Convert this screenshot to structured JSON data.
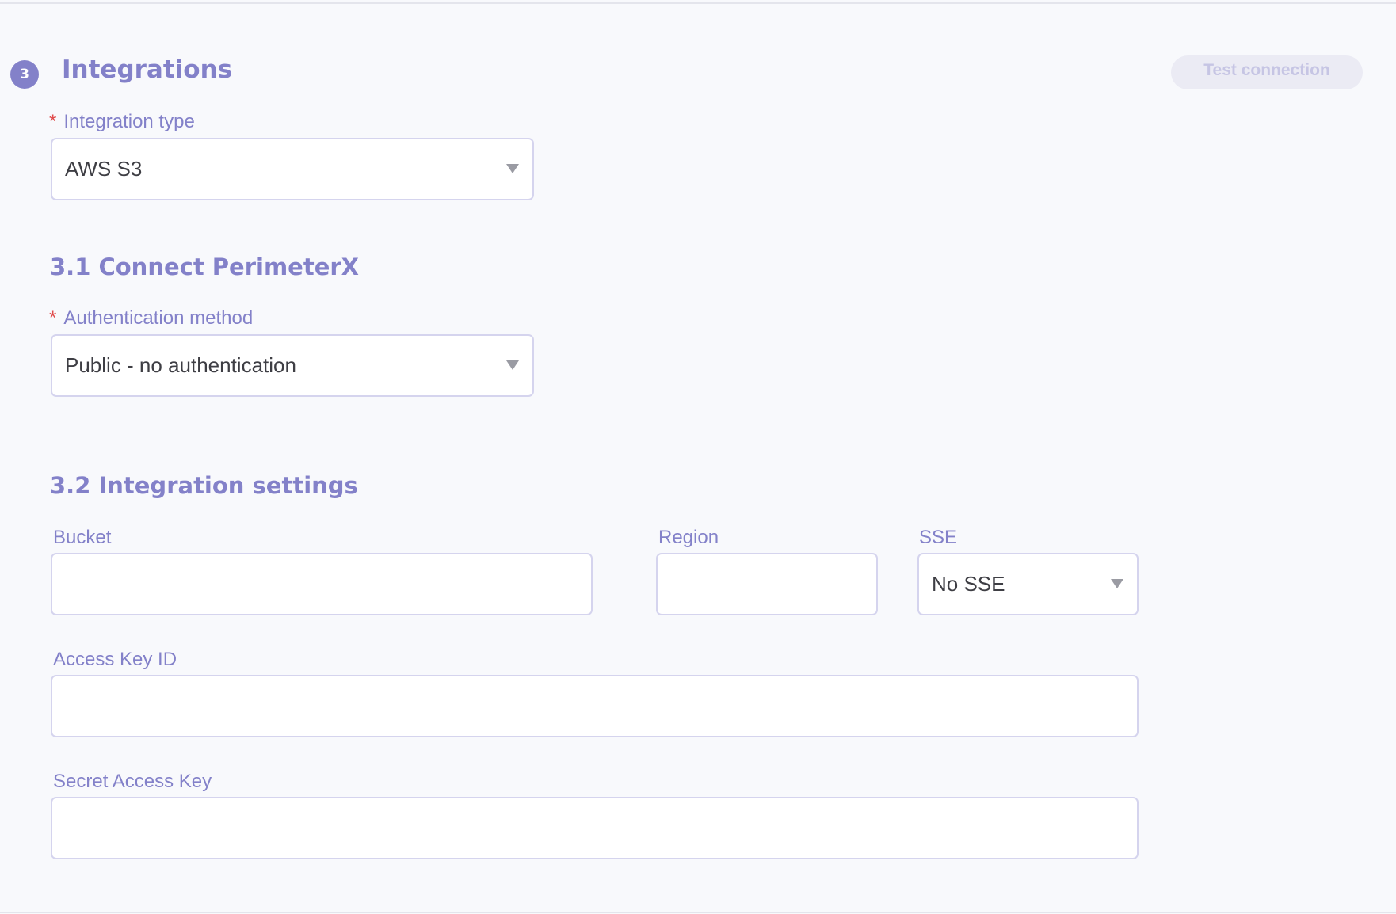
{
  "section": {
    "step_number": "3",
    "title": "Integrations",
    "test_connection_label": "Test connection"
  },
  "integration_type": {
    "required_mark": "*",
    "label": "Integration type",
    "value": "AWS S3"
  },
  "connect": {
    "title": "3.1 Connect PerimeterX",
    "auth_method": {
      "required_mark": "*",
      "label": "Authentication method",
      "value": "Public - no authentication"
    }
  },
  "settings": {
    "title": "3.2 Integration settings",
    "bucket": {
      "label": "Bucket",
      "value": ""
    },
    "region": {
      "label": "Region",
      "value": ""
    },
    "sse": {
      "label": "SSE",
      "value": "No SSE"
    },
    "access_key_id": {
      "label": "Access Key ID",
      "value": ""
    },
    "secret_access_key": {
      "label": "Secret Access Key",
      "value": ""
    }
  },
  "colors": {
    "accent": "#8381c9",
    "required": "#e04c4c",
    "border": "#d5d4ee",
    "background": "#f8f9fc",
    "button_disabled_bg": "#ebebf4",
    "button_disabled_text": "#c6c5e4"
  },
  "icons": {
    "dropdown": "chevron-down-icon"
  }
}
